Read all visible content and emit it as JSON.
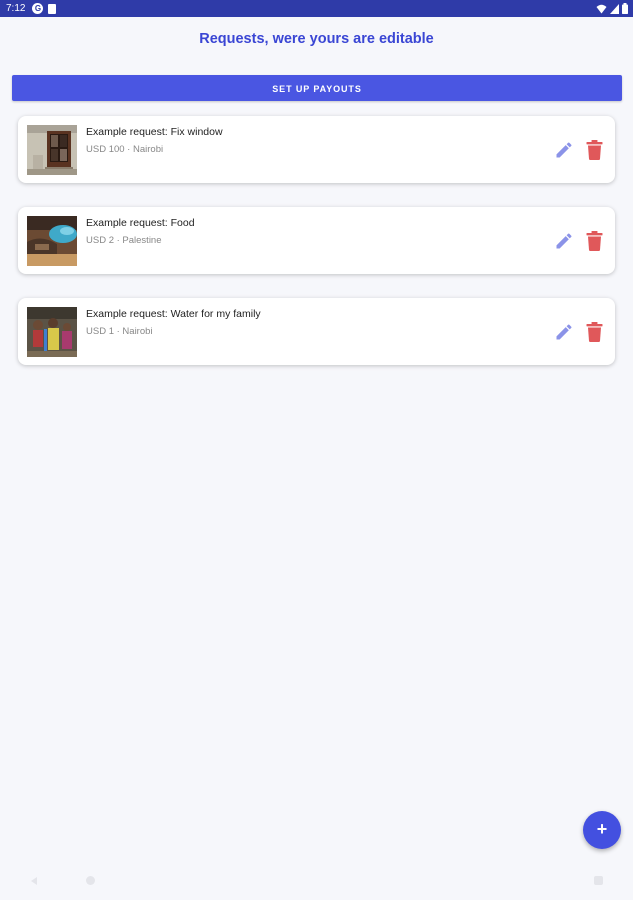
{
  "status_bar": {
    "time": "7:12",
    "g_icon_letter": "G"
  },
  "header": {
    "title": "Requests, were yours are editable"
  },
  "payouts_button": {
    "label": "SET UP PAYOUTS"
  },
  "requests": [
    {
      "title": "Example request: Fix window",
      "subtitle": "USD 100 · Nairobi",
      "thumbnail": "broken-window-photo"
    },
    {
      "title": "Example request: Food",
      "subtitle": "USD 2 · Palestine",
      "thumbnail": "food-photo"
    },
    {
      "title": "Example request: Water for my family",
      "subtitle": "USD 1 · Nairobi",
      "thumbnail": "water-family-photo"
    }
  ],
  "fab": {
    "label": "+"
  },
  "colors": {
    "status_bar": "#2f3ba8",
    "accent": "#4a56e2",
    "title": "#3a46d4",
    "edit_icon": "#8b93e8",
    "delete_icon": "#e0585a",
    "background": "#f6f7fb"
  }
}
